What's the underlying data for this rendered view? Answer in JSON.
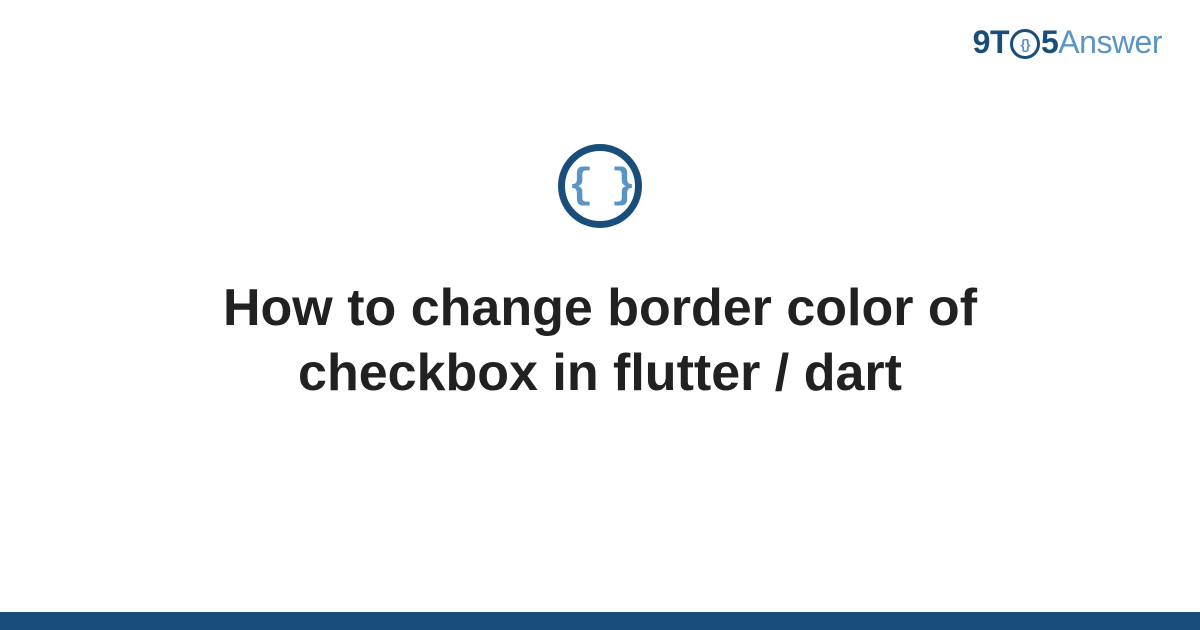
{
  "logo": {
    "part1": "9T",
    "circle_inner": "{}",
    "part2": "5",
    "part3": "Answer"
  },
  "category_icon": {
    "glyph": "{ }",
    "name": "code-braces-icon"
  },
  "title": "How to change border color of checkbox in flutter / dart",
  "colors": {
    "primary_dark": "#1a4e7a",
    "primary_light": "#5a94c7",
    "text": "#212121"
  }
}
